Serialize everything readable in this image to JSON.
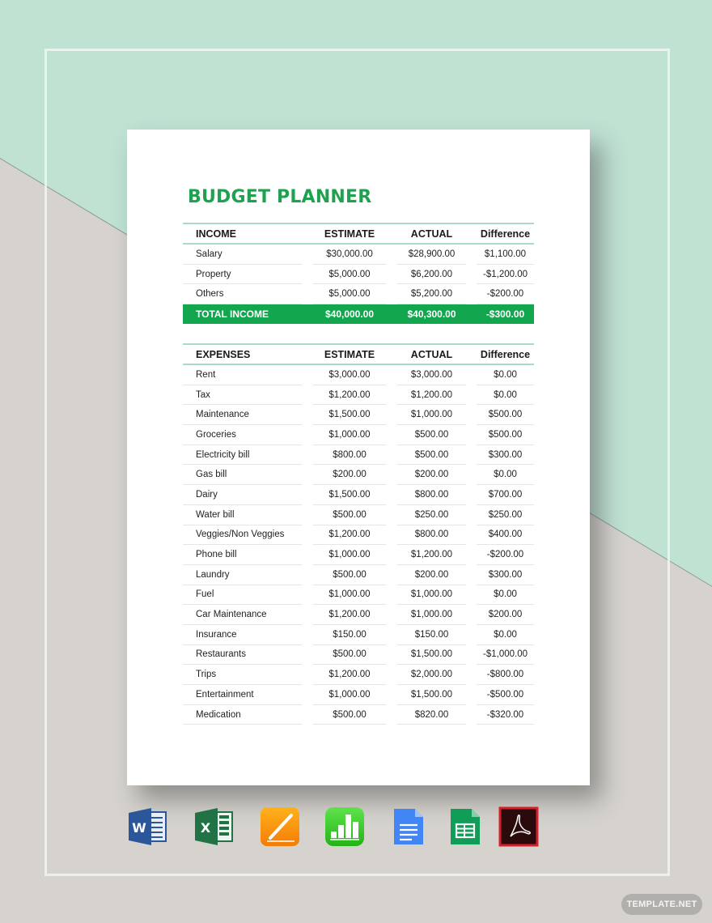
{
  "document": {
    "title": "BUDGET PLANNER",
    "income": {
      "headers": [
        "INCOME",
        "ESTIMATE",
        "ACTUAL",
        "Difference"
      ],
      "rows": [
        [
          "Salary",
          "$30,000.00",
          "$28,900.00",
          "$1,100.00"
        ],
        [
          "Property",
          "$5,000.00",
          "$6,200.00",
          "-$1,200.00"
        ],
        [
          "Others",
          "$5,000.00",
          "$5,200.00",
          "-$200.00"
        ]
      ],
      "total": [
        "TOTAL INCOME",
        "$40,000.00",
        "$40,300.00",
        "-$300.00"
      ]
    },
    "expenses": {
      "headers": [
        "EXPENSES",
        "ESTIMATE",
        "ACTUAL",
        "Difference"
      ],
      "rows": [
        [
          "Rent",
          "$3,000.00",
          "$3,000.00",
          "$0.00"
        ],
        [
          "Tax",
          "$1,200.00",
          "$1,200.00",
          "$0.00"
        ],
        [
          "Maintenance",
          "$1,500.00",
          "$1,000.00",
          "$500.00"
        ],
        [
          "Groceries",
          "$1,000.00",
          "$500.00",
          "$500.00"
        ],
        [
          "Electricity bill",
          "$800.00",
          "$500.00",
          "$300.00"
        ],
        [
          "Gas bill",
          "$200.00",
          "$200.00",
          "$0.00"
        ],
        [
          "Dairy",
          "$1,500.00",
          "$800.00",
          "$700.00"
        ],
        [
          "Water bill",
          "$500.00",
          "$250.00",
          "$250.00"
        ],
        [
          "Veggies/Non Veggies",
          "$1,200.00",
          "$800.00",
          "$400.00"
        ],
        [
          "Phone bill",
          "$1,000.00",
          "$1,200.00",
          "-$200.00"
        ],
        [
          "Laundry",
          "$500.00",
          "$200.00",
          "$300.00"
        ],
        [
          "Fuel",
          "$1,000.00",
          "$1,000.00",
          "$0.00"
        ],
        [
          "Car Maintenance",
          "$1,200.00",
          "$1,000.00",
          "$200.00"
        ],
        [
          "Insurance",
          "$150.00",
          "$150.00",
          "$0.00"
        ],
        [
          "Restaurants",
          "$500.00",
          "$1,500.00",
          "-$1,000.00"
        ],
        [
          "Trips",
          "$1,200.00",
          "$2,000.00",
          "-$800.00"
        ],
        [
          "Entertainment",
          "$1,000.00",
          "$1,500.00",
          "-$500.00"
        ],
        [
          "Medication",
          "$500.00",
          "$820.00",
          "-$320.00"
        ]
      ]
    }
  },
  "app_icons": [
    {
      "name": "word-icon",
      "letter": "W"
    },
    {
      "name": "excel-icon",
      "letter": "X"
    },
    {
      "name": "pages-icon"
    },
    {
      "name": "numbers-icon"
    },
    {
      "name": "google-docs-icon"
    },
    {
      "name": "google-sheets-icon"
    },
    {
      "name": "acrobat-pdf-icon"
    }
  ],
  "colors": {
    "accent_green": "#12a64e",
    "title_green": "#1fa24f",
    "rule_mint": "#a9dcc2",
    "bg_mint": "#bfe2d3",
    "bg_gray": "#d6d3ce"
  },
  "watermark": "TEMPLATE.NET"
}
